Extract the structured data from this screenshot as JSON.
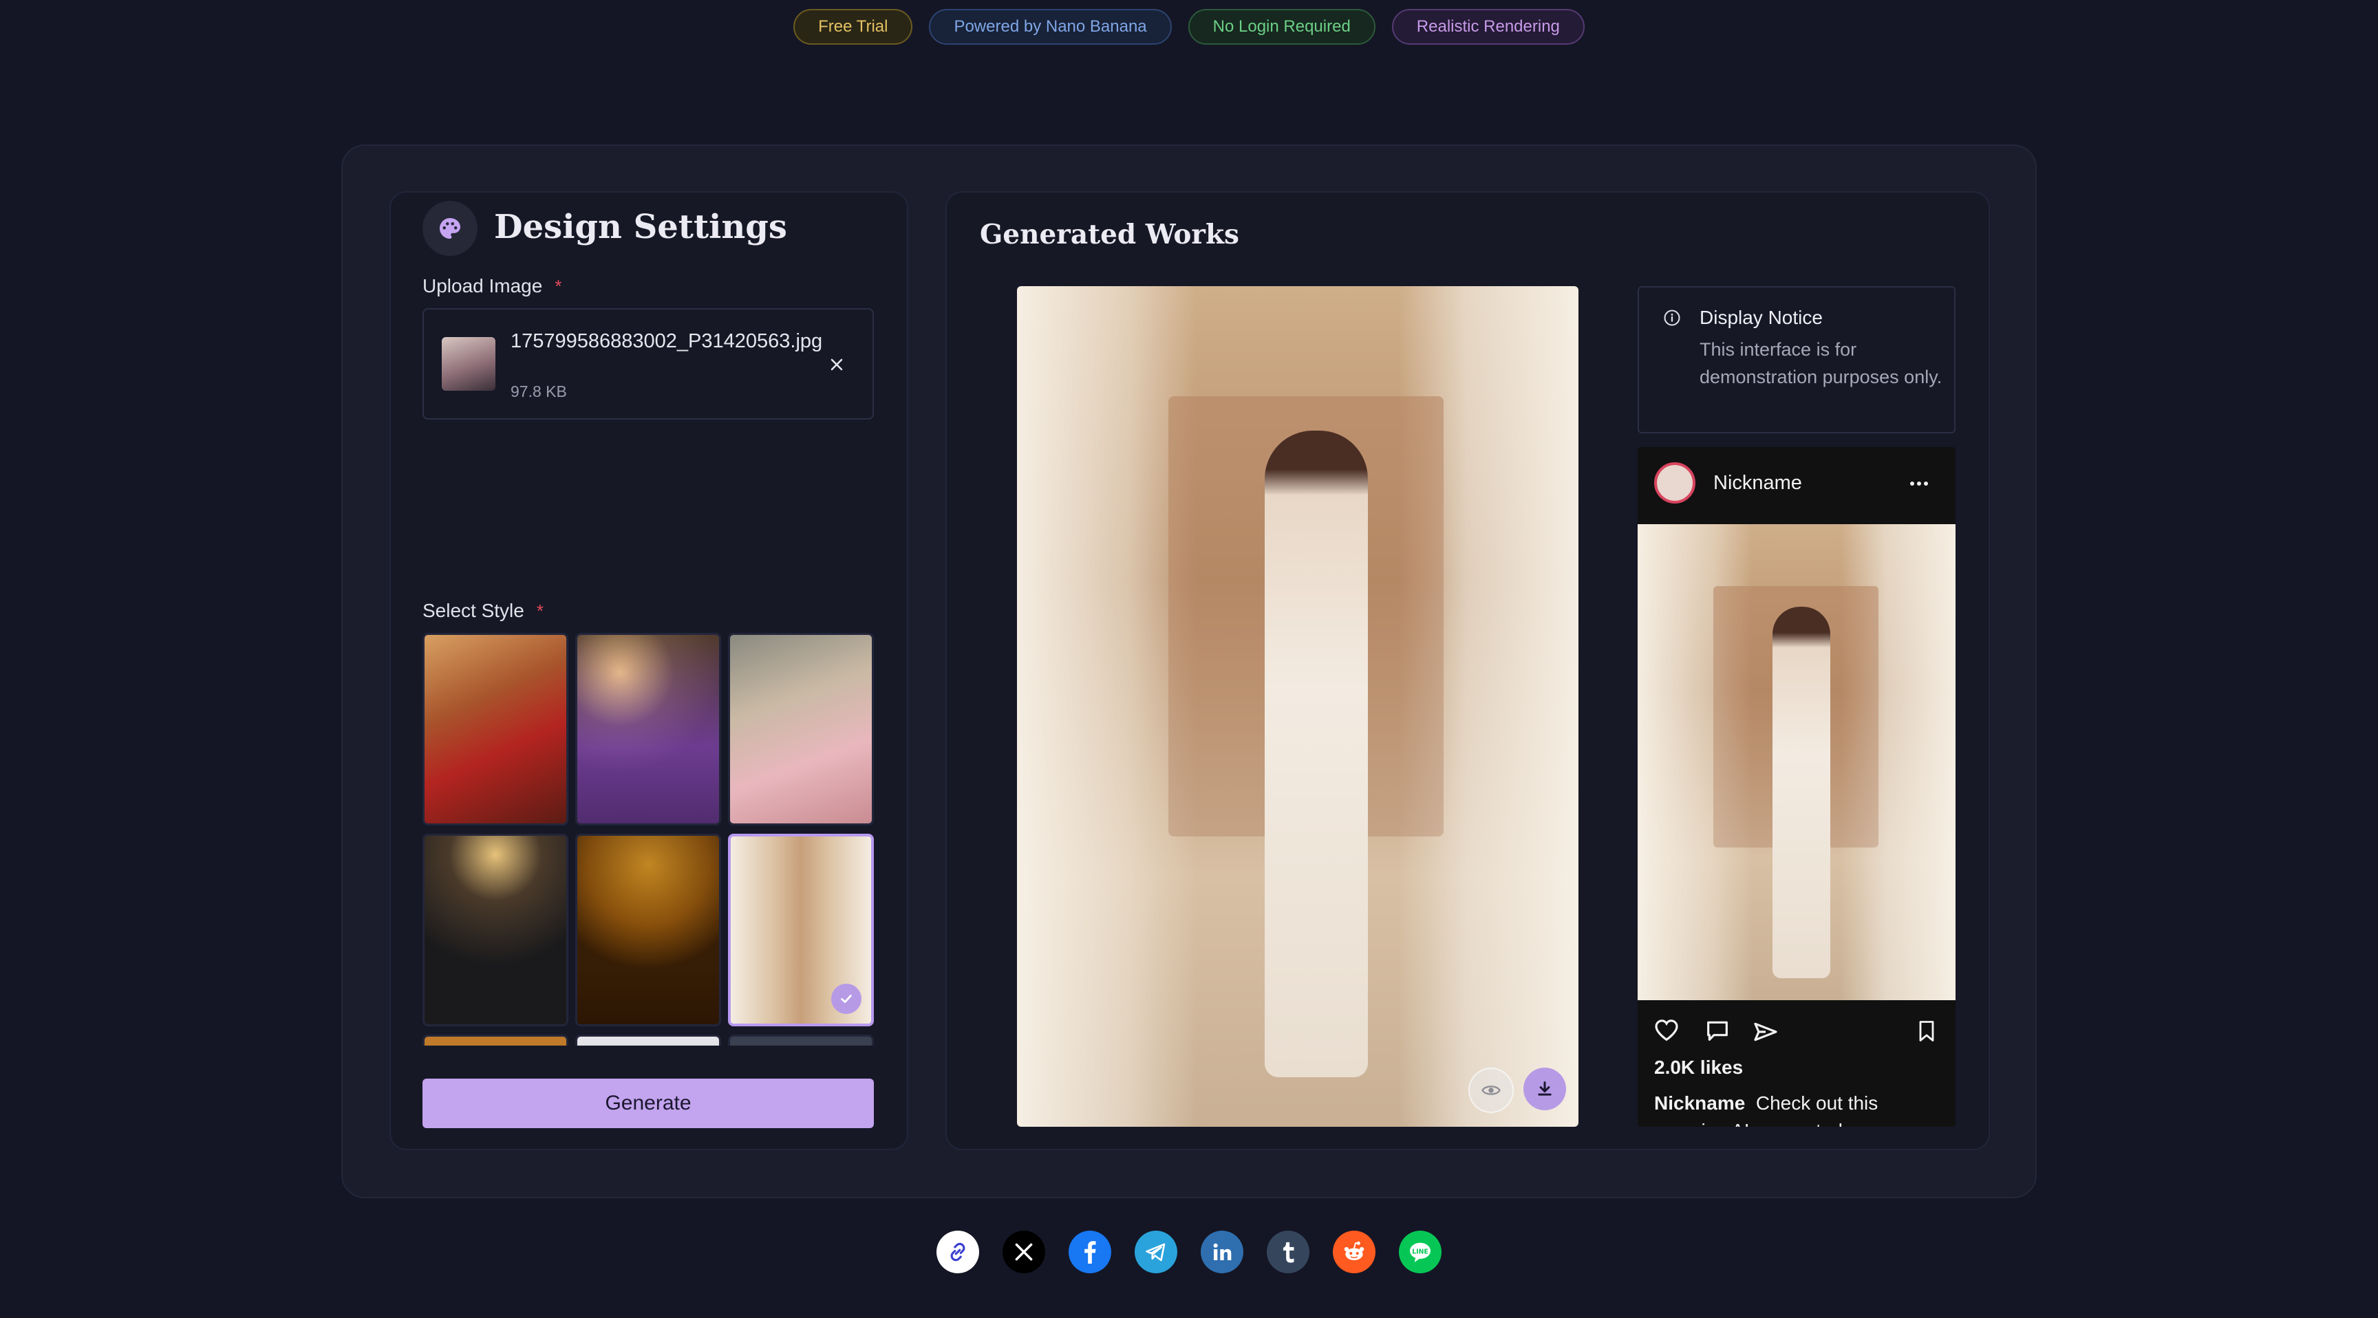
{
  "badges": [
    {
      "label": "Free Trial",
      "color": "#e3c163"
    },
    {
      "label": "Powered by Nano Banana",
      "color": "#7fa6e6"
    },
    {
      "label": "No Login Required",
      "color": "#6ccf86"
    },
    {
      "label": "Realistic Rendering",
      "color": "#c79ae8"
    }
  ],
  "design_settings": {
    "title": "Design Settings",
    "icon": "palette-icon",
    "upload_label": "Upload Image",
    "required_mark": "*",
    "file": {
      "name": "175799586883002_P31420563.jpg",
      "size": "97.8 KB"
    },
    "style_label": "Select Style",
    "styles": [
      "red-saree",
      "purple-saree",
      "pink-saree",
      "black-saree",
      "yellow-saree",
      "white-saree"
    ],
    "selected_style_index": 5,
    "generate_label": "Generate"
  },
  "generated": {
    "title": "Generated Works",
    "notice": {
      "title": "Display Notice",
      "text": "This interface is for demonstration purposes only."
    },
    "post": {
      "username": "Nickname",
      "likes": "2.0K likes",
      "caption_user": "Nickname",
      "caption_text": "Check out this amazing AI-generated scene"
    }
  },
  "social": [
    {
      "name": "copy-link-icon",
      "bg": "#ffffff"
    },
    {
      "name": "x-icon",
      "bg": "#000000"
    },
    {
      "name": "facebook-icon",
      "bg": "#1877f2"
    },
    {
      "name": "telegram-icon",
      "bg": "#2aa3dc"
    },
    {
      "name": "linkedin-icon",
      "bg": "#2f6fb0"
    },
    {
      "name": "tumblr-icon",
      "bg": "#35465c"
    },
    {
      "name": "reddit-icon",
      "bg": "#ff5a1f"
    },
    {
      "name": "line-icon",
      "bg": "#06c755"
    }
  ]
}
